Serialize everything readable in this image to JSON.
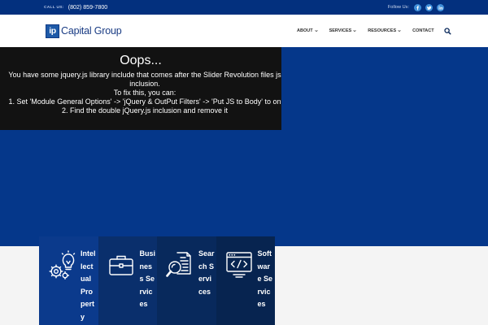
{
  "topbar": {
    "call_label": "CALL US:",
    "phone": "(802) 859-7800",
    "follow_label": "Follow Us:",
    "social_icons": [
      "facebook-icon",
      "twitter-icon",
      "linkedin-icon"
    ]
  },
  "header": {
    "logo": {
      "mark": "ip",
      "text": "Capital Group"
    },
    "nav": [
      {
        "label": "ABOUT",
        "has_dropdown": true
      },
      {
        "label": "SERVICES",
        "has_dropdown": true
      },
      {
        "label": "RESOURCES",
        "has_dropdown": true
      },
      {
        "label": "CONTACT",
        "has_dropdown": false
      }
    ],
    "search_icon": "search-icon"
  },
  "hero": {
    "error": {
      "title": "Oops...",
      "message": "You have some jquery.js library include that comes after the Slider Revolution files js inclusion.",
      "fix_intro": "To fix this, you can:",
      "steps": [
        "1. Set 'Module General Options' -> 'jQuery & OutPut Filters' -> 'Put JS to Body' to on",
        "2. Find the double jQuery.js inclusion and remove it"
      ]
    }
  },
  "services": [
    {
      "label": "Intellectual Property",
      "icon": "lightbulb-gears-icon",
      "color": "#0b3a8c"
    },
    {
      "label": "Business Services",
      "icon": "briefcase-icon",
      "color": "#0a2f6c"
    },
    {
      "label": "Search Services",
      "icon": "document-search-icon",
      "color": "#08295c"
    },
    {
      "label": "Software Services",
      "icon": "browser-window-icon",
      "color": "#072450"
    }
  ],
  "colors": {
    "topbar_bg": "#03307e",
    "hero_bg": "#05378a",
    "error_box_bg": "#121212",
    "page_bg": "#f4f4f4",
    "brand_blue": "#1a3c84",
    "logo_mark_bg": "#1e5aa8",
    "social_icon_bg": "#3f8ed8"
  }
}
